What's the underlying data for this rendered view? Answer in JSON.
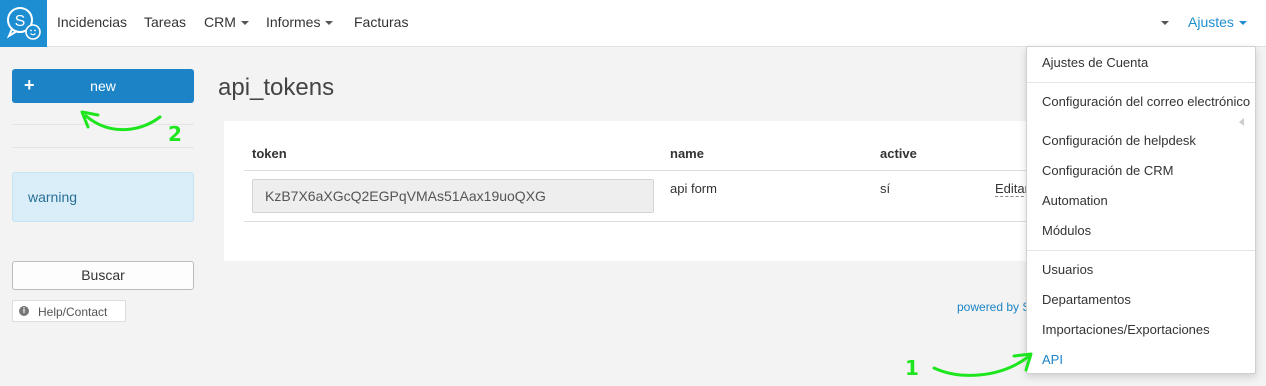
{
  "nav": {
    "items": [
      {
        "label": "Incidencias"
      },
      {
        "label": "Tareas"
      },
      {
        "label": "CRM"
      },
      {
        "label": "Informes"
      },
      {
        "label": "Facturas"
      }
    ],
    "settings_label": "Ajustes"
  },
  "sidebar": {
    "new_label": "new",
    "warning_text": "warning",
    "buscar_label": "Buscar",
    "help_label": "Help/Contact"
  },
  "main": {
    "title": "api_tokens",
    "columns": [
      "token",
      "name",
      "active"
    ],
    "rows": [
      {
        "token": "KzB7X6aXGcQ2EGPqVMAs51Aax19uoQXG",
        "name": "api form",
        "active": "sí",
        "edit": "Editar"
      }
    ],
    "powered_by": "powered by S"
  },
  "dropdown": {
    "items": [
      "Ajustes de Cuenta",
      "Configuración del correo electrónico",
      "Configuración de helpdesk",
      "Configuración de CRM",
      "Automation",
      "Módulos",
      "Usuarios",
      "Departamentos",
      "Importaciones/Exportaciones",
      "API"
    ]
  },
  "annotations": {
    "step1": "1",
    "step2": "2"
  },
  "colors": {
    "brand": "#1d8ed1",
    "primary_button": "#1c84c6",
    "annotation": "#1ee61e"
  }
}
